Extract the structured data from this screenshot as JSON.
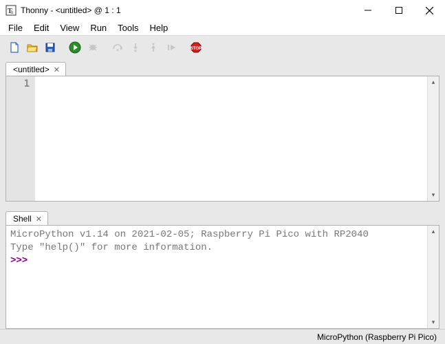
{
  "title": "Thonny  -  <untitled>  @  1 : 1",
  "menu": [
    "File",
    "Edit",
    "View",
    "Run",
    "Tools",
    "Help"
  ],
  "editor": {
    "tab_label": "<untitled>",
    "line_numbers": [
      "1"
    ],
    "content": ""
  },
  "shell": {
    "tab_label": "Shell",
    "line1": "MicroPython v1.14 on 2021-02-05; Raspberry Pi Pico with RP2040",
    "line2": "Type \"help()\" for more information.",
    "prompt": ">>>"
  },
  "status": {
    "interpreter": "MicroPython (Raspberry Pi Pico)"
  },
  "toolbar": {
    "new": "new-file-icon",
    "open": "open-file-icon",
    "save": "save-icon",
    "run": "run-icon",
    "debug": "debug-icon",
    "step_over": "step-over-icon",
    "step_into": "step-into-icon",
    "step_out": "step-out-icon",
    "resume": "resume-icon",
    "stop": "stop-icon"
  }
}
